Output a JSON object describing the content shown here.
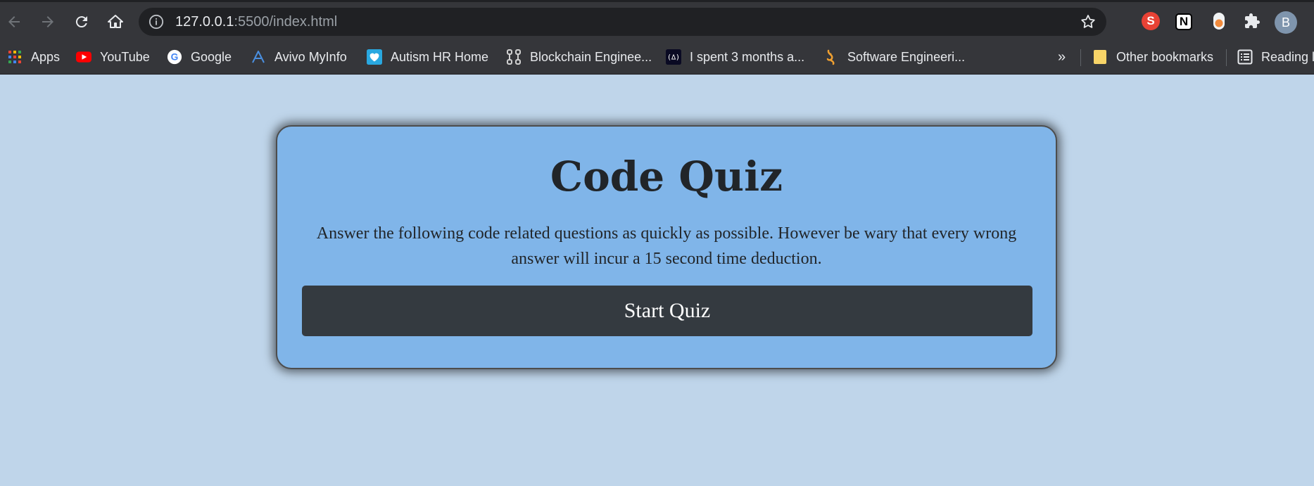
{
  "browser": {
    "url_host": "127.0.0.1",
    "url_rest": ":5500/index.html",
    "profile_initial": "B",
    "extensions": [
      {
        "icon": "s-extension-icon",
        "label": "S"
      },
      {
        "icon": "notion-icon",
        "label": "N"
      },
      {
        "icon": "toggle-extension-icon"
      },
      {
        "icon": "puzzle-icon"
      }
    ],
    "bookmarks": [
      {
        "label": "Apps",
        "icon": "apps-grid-icon"
      },
      {
        "label": "YouTube",
        "icon": "youtube-icon"
      },
      {
        "label": "Google",
        "icon": "google-icon"
      },
      {
        "label": "Avivo MyInfo",
        "icon": "avivo-icon"
      },
      {
        "label": "Autism HR Home",
        "icon": "heart-icon"
      },
      {
        "label": "Blockchain Enginee...",
        "icon": "blockchain-icon"
      },
      {
        "label": "I spent 3 months a...",
        "icon": "freecodecamp-icon"
      },
      {
        "label": "Software Engineeri...",
        "icon": "software-icon"
      }
    ],
    "overflow_label": "»",
    "other_bookmarks": "Other bookmarks",
    "reading_list": "Reading l"
  },
  "page": {
    "title": "Code Quiz",
    "description": "Answer the following code related questions as quickly as possible. However be wary that every wrong answer will incur a 15 second time deduction.",
    "start_button": "Start Quiz"
  },
  "colors": {
    "page_background": "#bfd5ea",
    "card_background": "#80b5e9",
    "button_background": "#343a40",
    "text": "#212529"
  }
}
